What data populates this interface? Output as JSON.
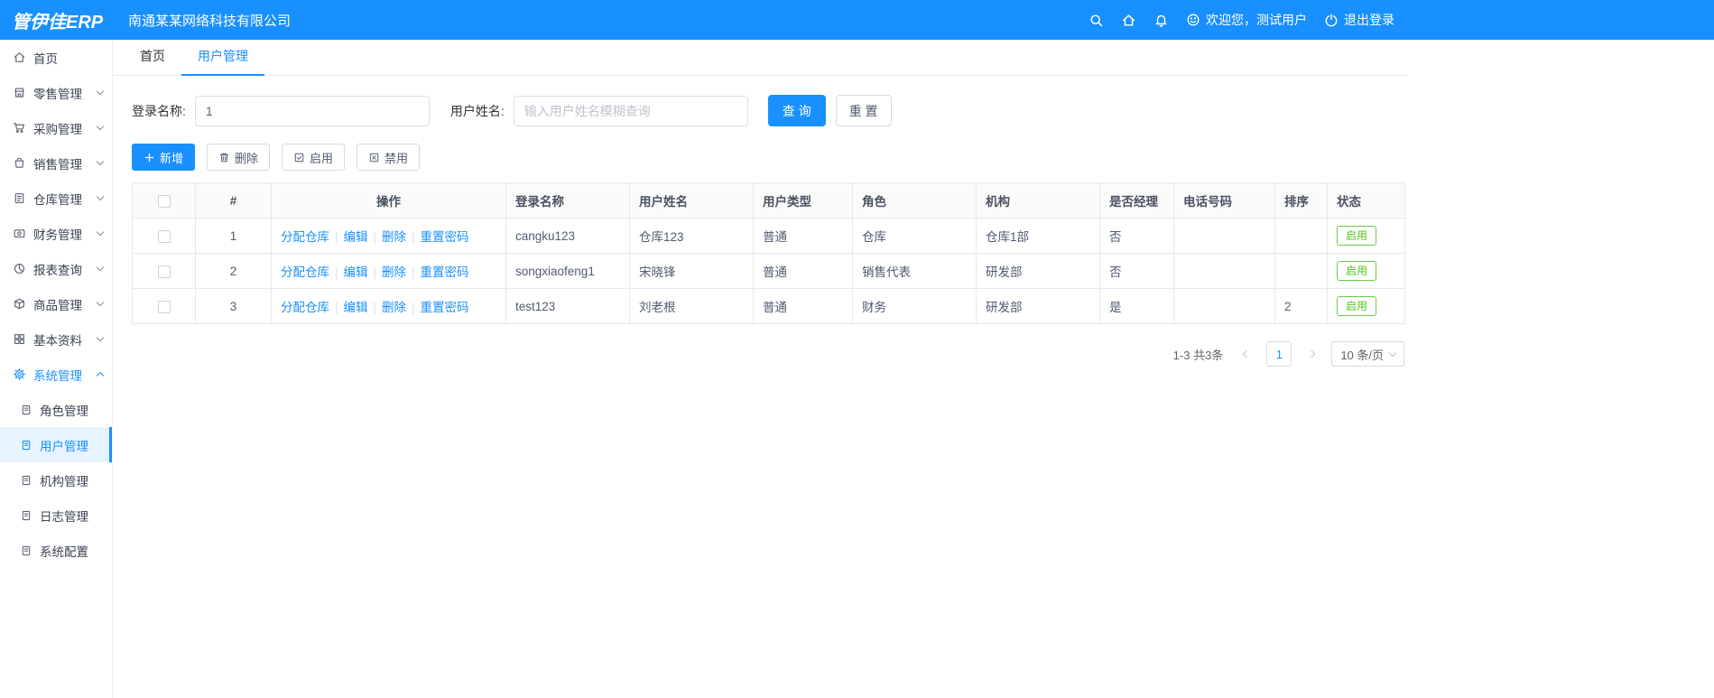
{
  "header": {
    "logo": "管伊佳ERP",
    "company": "南通某某网络科技有限公司",
    "welcome": "欢迎您，测试用户",
    "logout": "退出登录"
  },
  "sidebar": {
    "items": [
      {
        "label": "首页"
      },
      {
        "label": "零售管理"
      },
      {
        "label": "采购管理"
      },
      {
        "label": "销售管理"
      },
      {
        "label": "仓库管理"
      },
      {
        "label": "财务管理"
      },
      {
        "label": "报表查询"
      },
      {
        "label": "商品管理"
      },
      {
        "label": "基本资料"
      },
      {
        "label": "系统管理"
      }
    ],
    "subitems": [
      {
        "label": "角色管理"
      },
      {
        "label": "用户管理"
      },
      {
        "label": "机构管理"
      },
      {
        "label": "日志管理"
      },
      {
        "label": "系统配置"
      }
    ]
  },
  "tabs": [
    {
      "label": "首页"
    },
    {
      "label": "用户管理"
    }
  ],
  "search": {
    "login_label": "登录名称:",
    "login_value": "1",
    "name_label": "用户姓名:",
    "name_placeholder": "输入用户姓名模糊查询",
    "query_label": "查 询",
    "reset_label": "重 置"
  },
  "toolbar": {
    "add_label": "新增",
    "delete_label": "删除",
    "enable_label": "启用",
    "disable_label": "禁用"
  },
  "table": {
    "headers": [
      "#",
      "操作",
      "登录名称",
      "用户姓名",
      "用户类型",
      "角色",
      "机构",
      "是否经理",
      "电话号码",
      "排序",
      "状态"
    ],
    "op_links": [
      "分配仓库",
      "编辑",
      "删除",
      "重置密码"
    ],
    "rows": [
      {
        "num": "1",
        "login": "cangku123",
        "name": "仓库123",
        "type": "普通",
        "role": "仓库",
        "org": "仓库1部",
        "manager": "否",
        "phone": "",
        "sort": "",
        "status": "启用"
      },
      {
        "num": "2",
        "login": "songxiaofeng1",
        "name": "宋晓锋",
        "type": "普通",
        "role": "销售代表",
        "org": "研发部",
        "manager": "否",
        "phone": "",
        "sort": "",
        "status": "启用"
      },
      {
        "num": "3",
        "login": "test123",
        "name": "刘老根",
        "type": "普通",
        "role": "财务",
        "org": "研发部",
        "manager": "是",
        "phone": "",
        "sort": "2",
        "status": "启用"
      }
    ]
  },
  "pagination": {
    "total_text": "1-3 共3条",
    "current_page": "1",
    "page_size": "10 条/页"
  },
  "colors": {
    "primary": "#1890ff",
    "success": "#52c41a"
  }
}
